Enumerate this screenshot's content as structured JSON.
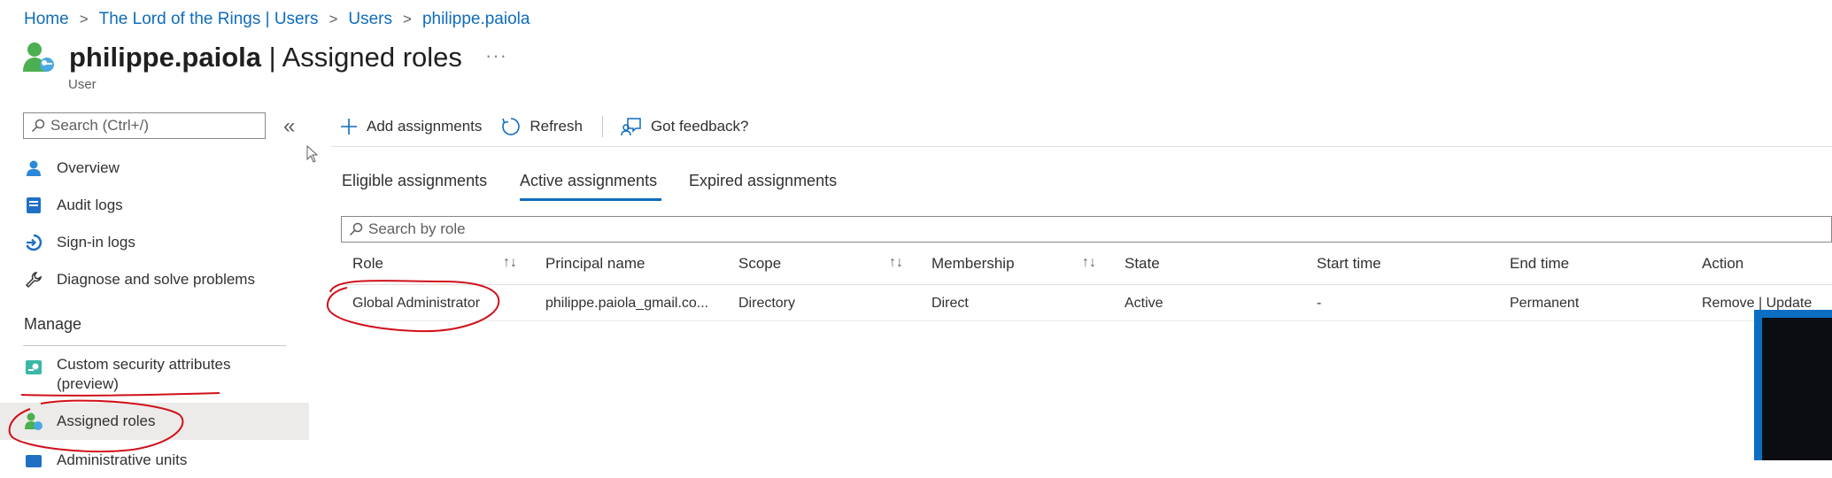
{
  "breadcrumb": [
    "Home",
    "The Lord of the Rings | Users",
    "Users",
    "philippe.paiola"
  ],
  "page": {
    "title_name": "philippe.paiola",
    "title_suffix": " | Assigned roles",
    "more": "···",
    "subtitle": "User"
  },
  "sidebar": {
    "search_placeholder": "Search (Ctrl+/)",
    "collapse": "«",
    "items": [
      {
        "label": "Overview",
        "icon": "user-icon"
      },
      {
        "label": "Audit logs",
        "icon": "audit-log-icon"
      },
      {
        "label": "Sign-in logs",
        "icon": "sign-in-icon"
      },
      {
        "label": "Diagnose and solve problems",
        "icon": "wrench-icon"
      }
    ],
    "manage_label": "Manage",
    "manage_items": [
      {
        "label": "Custom security attributes",
        "label2": "(preview)",
        "icon": "attributes-icon"
      },
      {
        "label": "Assigned roles",
        "icon": "user-role-icon",
        "active": true
      },
      {
        "label": "Administrative units",
        "icon": "admin-units-icon"
      }
    ]
  },
  "toolbar": {
    "add_label": "Add assignments",
    "refresh_label": "Refresh",
    "feedback_label": "Got feedback?"
  },
  "tabs": [
    "Eligible assignments",
    "Active assignments",
    "Expired assignments"
  ],
  "active_tab": "Active assignments",
  "table": {
    "search_placeholder": "Search by role",
    "sort_glyph": "↑↓",
    "columns": [
      "Role",
      "Principal name",
      "Scope",
      "Membership",
      "State",
      "Start time",
      "End time",
      "Action"
    ],
    "rows": [
      [
        "Global Administrator",
        "philippe.paiola_gmail.co...",
        "Directory",
        "Direct",
        "Active",
        "-",
        "Permanent",
        "Remove | Update"
      ]
    ]
  },
  "colors": {
    "accent": "#0f6cbd",
    "annotation": "#d0101a",
    "video_frame": "#0a6fc2"
  }
}
